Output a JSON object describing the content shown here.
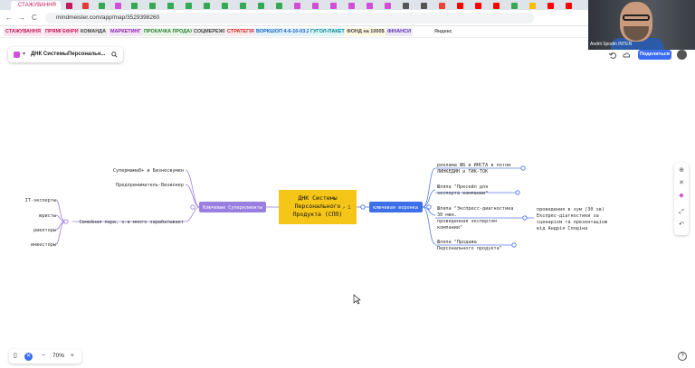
{
  "browser": {
    "active_tab_label": "СТАЖУВАННЯ",
    "url": "mindmeister.com/app/map/3529398260",
    "nav": {
      "back": "←",
      "forward": "→",
      "reload": "C"
    }
  },
  "bookmarks": [
    {
      "label": "СТАЖУВАННЯ",
      "color": "#c2185b",
      "bg": "#fde3ee"
    },
    {
      "label": "ПРЯМІ ЕФІРИ",
      "color": "#c2185b",
      "bg": "#fde3ee"
    },
    {
      "label": "КОМАНДА",
      "color": "#444",
      "bg": "#eee"
    },
    {
      "label": "МАРКЕТИНГ",
      "color": "#8e24aa",
      "bg": "#f3e5f5"
    },
    {
      "label": "ПРОКАЧКА ПРОДАЖ",
      "color": "#2e7d32",
      "bg": "#e8f5e9"
    },
    {
      "label": "СОЦМЕРЕЖІ",
      "color": "#444",
      "bg": "#eee"
    },
    {
      "label": "СТРАТЕГІЯ",
      "color": "#c62828",
      "bg": "#ffebee"
    },
    {
      "label": "ВОРКШОП 4-6-10-03.25",
      "color": "#1565c0",
      "bg": "#e3f2fd"
    },
    {
      "label": "ГУГОЛ-ПАКЕТ",
      "color": "#00838f",
      "bg": "#e0f7fa"
    },
    {
      "label": "ФОНД на 1000$",
      "color": "#444",
      "bg": "#fff8e1"
    },
    {
      "label": "ФІНАНСИ",
      "color": "#5e35b1",
      "bg": "#ede7f6"
    },
    {
      "label": "Яндекс",
      "color": "#555",
      "bg": "#fff"
    }
  ],
  "video": {
    "participant_name": "Andrii Spodin INTEN"
  },
  "map_header": {
    "title": "ДНК СистемыПерсональн...",
    "search_icon": "search-icon"
  },
  "top_actions": {
    "share_label": "Поделиться",
    "icons": [
      "undo-icon",
      "cloud-icon"
    ]
  },
  "right_toolbar": {
    "icons": [
      "add-icon",
      "close-icon",
      "paint-icon",
      "expand-icon",
      "undo-icon"
    ]
  },
  "zoom": {
    "level": "70%",
    "minus": "−",
    "plus": "+"
  },
  "help_label": "?",
  "mindmap": {
    "root": {
      "lines": [
        "ДНК Системы",
        "Персонального",
        "Продукта (СПП)"
      ],
      "link_badge": "⇗ 1"
    },
    "left_topic": "Ключевые Суперклиенты",
    "right_topic": "ключевая воронка",
    "left_items": [
      "Супермама8+ и Бизнесвумен",
      "Предприниматель-Визионер",
      "Семейная пара, х-и много зарабатывает"
    ],
    "left_sub": [
      "IT-эксперты",
      "юристы",
      "риелторы",
      "инвесторы"
    ],
    "right_items": [
      [
        "реклама ФБ и ИНСТА в потом",
        "ЛИНКЕДИН и ТИК-ТОК"
      ],
      [
        "Шляпа \"Пресейл для",
        "эксперта компании\""
      ],
      [
        "Шляпа \"Экспресс-диагностика",
        "30 мин.",
        "проведенная экспертом",
        "компании\""
      ],
      [
        "Шляпа \"Продажа",
        "Персонального продукта\""
      ]
    ],
    "right_sub": [
      "проведения в зум (30 хв)",
      "Експрес-діагностики за",
      "сценарієм та презентацією",
      "від Андрія Сподіна"
    ]
  }
}
